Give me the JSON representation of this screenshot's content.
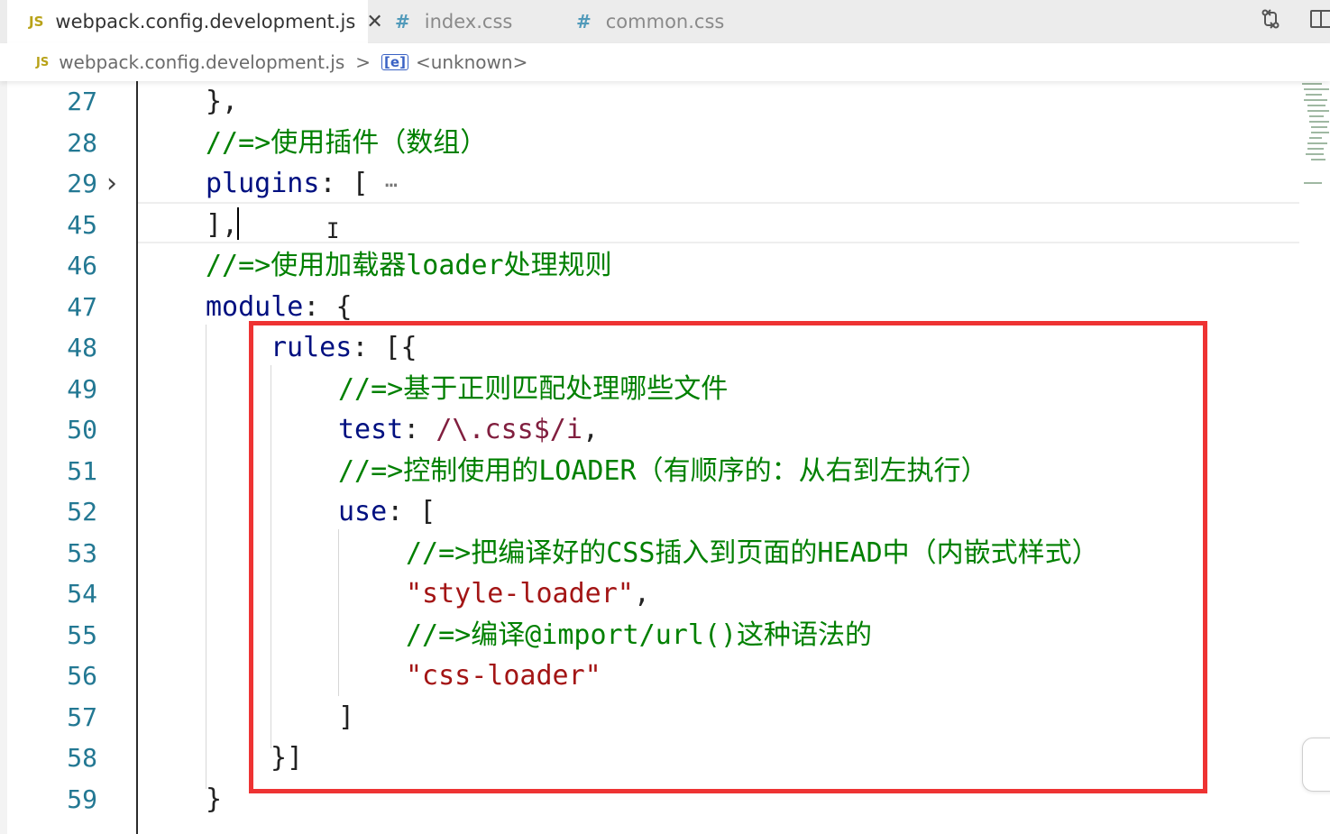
{
  "tabs": [
    {
      "icon_text": "JS",
      "label": "webpack.config.development.js",
      "close": "✕",
      "active": true
    },
    {
      "icon_text": "#",
      "label": "index.css",
      "active": false
    },
    {
      "icon_text": "#",
      "label": "common.css",
      "active": false
    }
  ],
  "toolbar_icons": [
    "compare-changes-icon",
    "split-editor-icon"
  ],
  "breadcrumb": {
    "file_icon": "JS",
    "file": "webpack.config.development.js",
    "separator": ">",
    "symbol_icon": "[e]",
    "symbol": "<unknown>"
  },
  "editor": {
    "lines": [
      {
        "num": "27",
        "parts": [
          {
            "t": "},",
            "c": ""
          }
        ]
      },
      {
        "num": "28",
        "parts": [
          {
            "t": "//=>使用插件（数组）",
            "c": "c"
          }
        ]
      },
      {
        "num": "29",
        "folded": true,
        "parts": [
          {
            "t": "plugins",
            "c": "k"
          },
          {
            "t": ": [ ",
            "c": ""
          },
          {
            "t": "⋯",
            "c": "fold-dots"
          }
        ]
      },
      {
        "num": "45",
        "parts": [
          {
            "t": "],",
            "c": ""
          }
        ]
      },
      {
        "num": "46",
        "parts": [
          {
            "t": "//=>使用加载器loader处理规则",
            "c": "c"
          }
        ]
      },
      {
        "num": "47",
        "parts": [
          {
            "t": "module",
            "c": "k"
          },
          {
            "t": ": {",
            "c": ""
          }
        ]
      },
      {
        "num": "48",
        "parts": [
          {
            "t": "rules",
            "c": "k"
          },
          {
            "t": ": [{",
            "c": ""
          }
        ]
      },
      {
        "num": "49",
        "parts": [
          {
            "t": "//=>基于正则匹配处理哪些文件",
            "c": "c"
          }
        ]
      },
      {
        "num": "50",
        "parts": [
          {
            "t": "test",
            "c": "k"
          },
          {
            "t": ": ",
            "c": ""
          },
          {
            "t": "/\\.css$/i",
            "c": "r"
          },
          {
            "t": ",",
            "c": ""
          }
        ]
      },
      {
        "num": "51",
        "parts": [
          {
            "t": "//=>控制使用的LOADER（有顺序的：从右到左执行）",
            "c": "c"
          }
        ]
      },
      {
        "num": "52",
        "parts": [
          {
            "t": "use",
            "c": "k"
          },
          {
            "t": ": [",
            "c": ""
          }
        ]
      },
      {
        "num": "53",
        "parts": [
          {
            "t": "//=>把编译好的CSS插入到页面的HEAD中（内嵌式样式）",
            "c": "c"
          }
        ]
      },
      {
        "num": "54",
        "parts": [
          {
            "t": "\"style-loader\"",
            "c": "s"
          },
          {
            "t": ",",
            "c": ""
          }
        ]
      },
      {
        "num": "55",
        "parts": [
          {
            "t": "//=>编译@import/url()这种语法的",
            "c": "c"
          }
        ]
      },
      {
        "num": "56",
        "parts": [
          {
            "t": "\"css-loader\"",
            "c": "s"
          }
        ]
      },
      {
        "num": "57",
        "parts": [
          {
            "t": "]",
            "c": ""
          }
        ]
      },
      {
        "num": "58",
        "parts": [
          {
            "t": "}]",
            "c": ""
          }
        ]
      },
      {
        "num": "59",
        "parts": [
          {
            "t": "}",
            "c": ""
          }
        ]
      }
    ]
  },
  "colors": {
    "keyword": "#001080",
    "comment": "#008000",
    "string": "#a31515",
    "regex": "#811f3f",
    "line_number": "#237893",
    "highlight_box": "#ee3333"
  }
}
